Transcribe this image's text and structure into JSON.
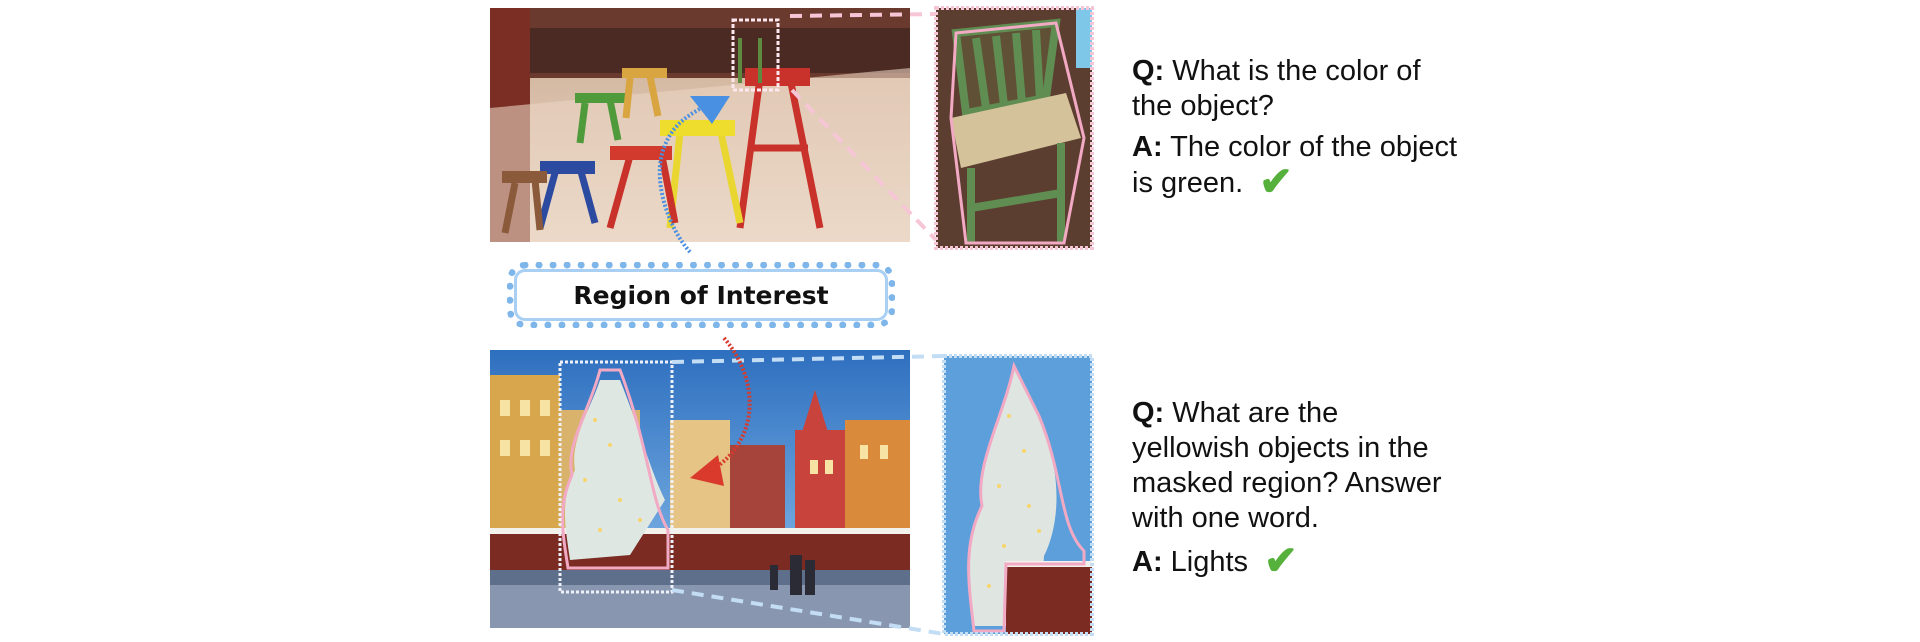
{
  "region_label": "Region of Interest",
  "top_example": {
    "q_prefix": "Q:",
    "question": "What is the color of the object?",
    "a_prefix": "A:",
    "answer": "The color of the object is green.",
    "check": "✔"
  },
  "bottom_example": {
    "q_prefix": "Q:",
    "question": "What are the yellowish objects in the masked region? Answer with one word.",
    "a_prefix": "A:",
    "answer": "Lights",
    "check": "✔"
  },
  "colors": {
    "mask_pink": "#f2a9c4",
    "roi_blue": "#7fb6ea",
    "check_green": "#55b13b",
    "arrow_red": "#d93a2b",
    "arrow_blue": "#4a90e2"
  }
}
